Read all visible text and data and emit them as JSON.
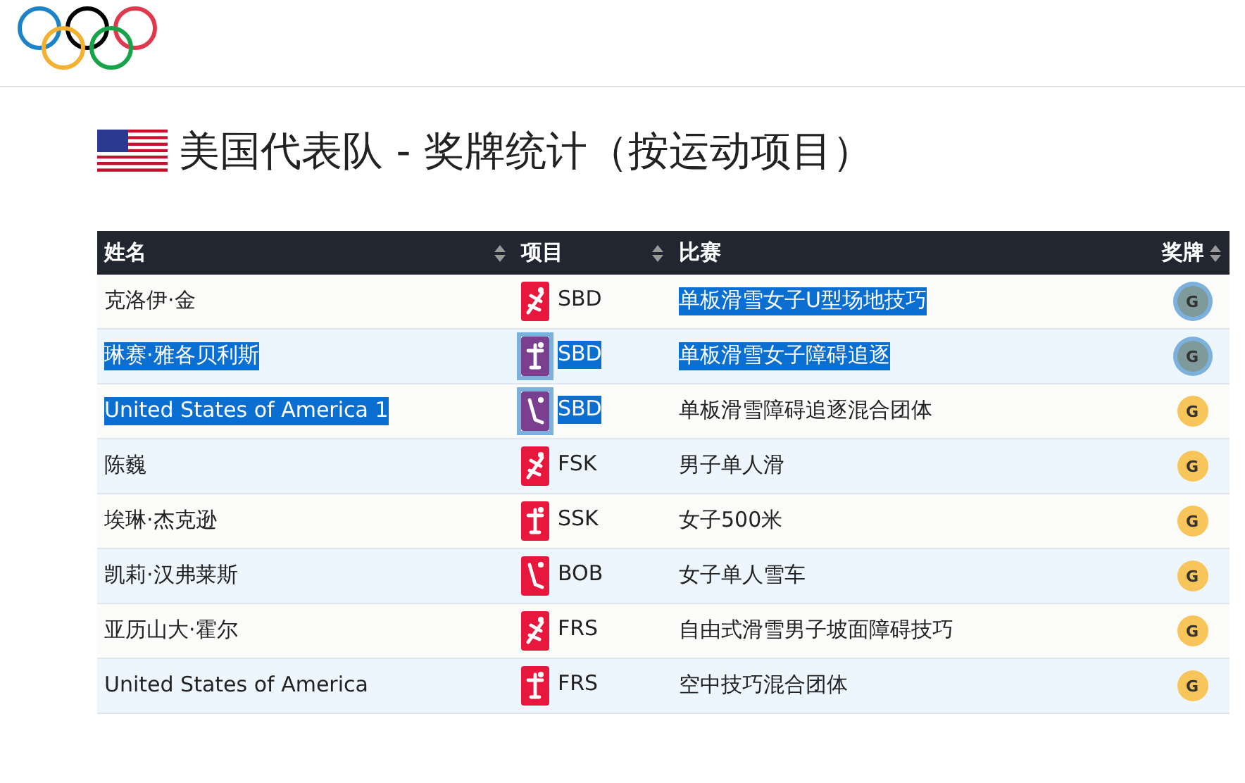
{
  "title": "美国代表队 - 奖牌统计（按运动项目）",
  "table": {
    "columns": [
      {
        "label": "姓名",
        "sortable": true
      },
      {
        "label": "项目",
        "sortable": true
      },
      {
        "label": "比赛",
        "sortable": false
      },
      {
        "label": "奖牌",
        "sortable": true
      }
    ],
    "rows": [
      {
        "name": "克洛伊·金",
        "sport": "SBD",
        "event": "单板滑雪女子U型场地技巧",
        "medal": "G",
        "highlighted": {
          "name": false,
          "sport": false,
          "event": true,
          "medal": true
        }
      },
      {
        "name": "琳赛·雅各贝利斯",
        "sport": "SBD",
        "event": "单板滑雪女子障碍追逐",
        "medal": "G",
        "highlighted": {
          "name": true,
          "sport": true,
          "event": true,
          "medal": true
        }
      },
      {
        "name": "United States of America 1",
        "sport": "SBD",
        "event": "单板滑雪障碍追逐混合团体",
        "medal": "G",
        "highlighted": {
          "name": true,
          "sport": true,
          "event": false,
          "medal": false
        }
      },
      {
        "name": "陈巍",
        "sport": "FSK",
        "event": "男子单人滑",
        "medal": "G",
        "highlighted": {
          "name": false,
          "sport": false,
          "event": false,
          "medal": false
        }
      },
      {
        "name": "埃琳·杰克逊",
        "sport": "SSK",
        "event": "女子500米",
        "medal": "G",
        "highlighted": {
          "name": false,
          "sport": false,
          "event": false,
          "medal": false
        }
      },
      {
        "name": "凯莉·汉弗莱斯",
        "sport": "BOB",
        "event": "女子单人雪车",
        "medal": "G",
        "highlighted": {
          "name": false,
          "sport": false,
          "event": false,
          "medal": false
        }
      },
      {
        "name": "亚历山大·霍尔",
        "sport": "FRS",
        "event": "自由式滑雪男子坡面障碍技巧",
        "medal": "G",
        "highlighted": {
          "name": false,
          "sport": false,
          "event": false,
          "medal": false
        }
      },
      {
        "name": "United States of America",
        "sport": "FRS",
        "event": "空中技巧混合团体",
        "medal": "G",
        "highlighted": {
          "name": false,
          "sport": false,
          "event": false,
          "medal": false
        }
      }
    ]
  }
}
